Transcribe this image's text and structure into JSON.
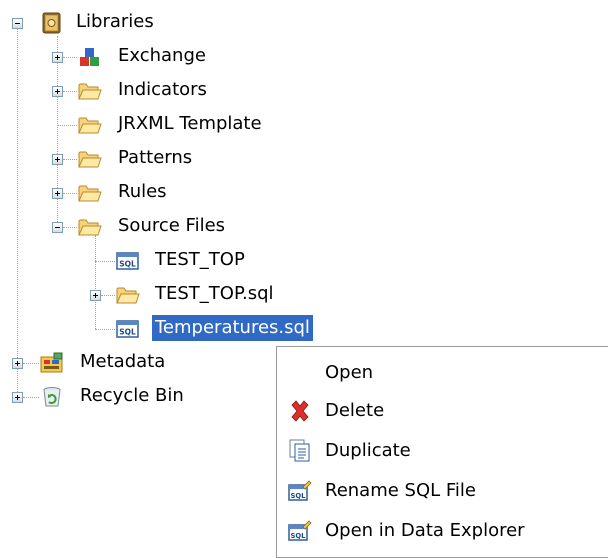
{
  "tree": {
    "libraries": "Libraries",
    "exchange": "Exchange",
    "indicators": "Indicators",
    "jrxml_template": "JRXML Template",
    "patterns": "Patterns",
    "rules": "Rules",
    "source_files": "Source Files",
    "test_top": "TEST_TOP",
    "test_top_sql": "TEST_TOP.sql",
    "temperatures_sql": "Temperatures.sql",
    "metadata": "Metadata",
    "recycle_bin": "Recycle Bin"
  },
  "icons": {
    "libraries": "library-book-icon",
    "exchange": "exchange-cubes-icon",
    "folder": "folder-icon",
    "sql_file": "sql-file-icon",
    "metadata": "metadata-icon",
    "recycle_bin": "recycle-bin-icon",
    "delete": "delete-x-icon",
    "duplicate": "duplicate-document-icon",
    "rename": "rename-sql-icon",
    "open_explorer": "open-explorer-sql-icon"
  },
  "context_menu": {
    "open": "Open",
    "delete": "Delete",
    "duplicate": "Duplicate",
    "rename_sql_file": "Rename SQL File",
    "open_in_data_explorer": "Open in Data Explorer"
  },
  "colors": {
    "selection": "#316ac5",
    "folder": "#f3c94f",
    "delete_red": "#d9302a"
  }
}
